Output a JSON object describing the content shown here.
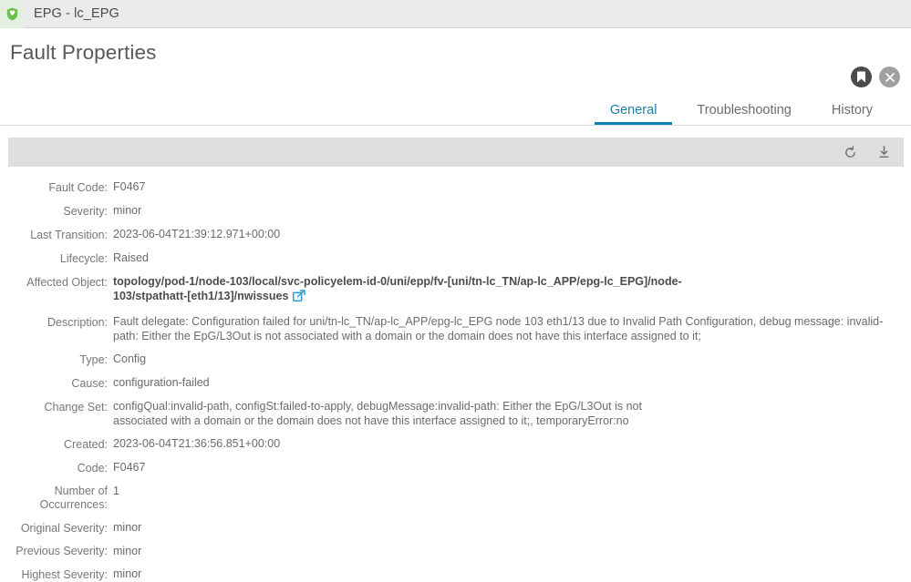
{
  "window": {
    "title": "EPG - lc_EPG",
    "icon": "shield-icon"
  },
  "dialog": {
    "title": "Fault Properties",
    "actions": [
      {
        "name": "bookmark-button",
        "icon": "bookmark-icon"
      },
      {
        "name": "close-button",
        "icon": "close-icon"
      }
    ]
  },
  "tabs": [
    {
      "label": "General",
      "active": true
    },
    {
      "label": "Troubleshooting",
      "active": false
    },
    {
      "label": "History",
      "active": false
    }
  ],
  "toolbar": {
    "refresh_icon": "refresh-icon",
    "download_icon": "download-icon"
  },
  "properties": [
    {
      "label": "Fault Code:",
      "value": "F0467"
    },
    {
      "label": "Severity:",
      "value": "minor"
    },
    {
      "label": "Last Transition:",
      "value": "2023-06-04T21:39:12.971+00:00"
    },
    {
      "label": "Lifecycle:",
      "value": "Raised"
    },
    {
      "label": "Affected Object:",
      "value": "topology/pod-1/node-103/local/svc-policyelem-id-0/uni/epp/fv-[uni/tn-lc_TN/ap-lc_APP/epg-lc_EPG]/node-103/stpathatt-[eth1/13]/nwissues"
    },
    {
      "label": "Description:",
      "value": "Fault delegate: Configuration failed for uni/tn-lc_TN/ap-lc_APP/epg-lc_EPG node 103 eth1/13 due to Invalid Path Configuration, debug message: invalid-path: Either the EpG/L3Out is not associated with a domain or the domain does not have this interface assigned to it;"
    },
    {
      "label": "Type:",
      "value": "Config"
    },
    {
      "label": "Cause:",
      "value": "configuration-failed"
    },
    {
      "label": "Change Set:",
      "value": "configQual:invalid-path, configSt:failed-to-apply, debugMessage:invalid-path: Either the EpG/L3Out is not associated with a domain or the domain does not have this interface assigned to it;, temporaryError:no"
    },
    {
      "label": "Created:",
      "value": "2023-06-04T21:36:56.851+00:00"
    },
    {
      "label": "Code:",
      "value": "F0467"
    },
    {
      "label": "Number of Occurrences:",
      "value": "1"
    },
    {
      "label": "Original Severity:",
      "value": "minor"
    },
    {
      "label": "Previous Severity:",
      "value": "minor"
    },
    {
      "label": "Highest Severity:",
      "value": "minor"
    }
  ],
  "colors": {
    "accent": "#1080b0",
    "shield_green": "#6dbe4b",
    "link_blue": "#1a9ad6",
    "toolbar_grey": "#dededf"
  }
}
